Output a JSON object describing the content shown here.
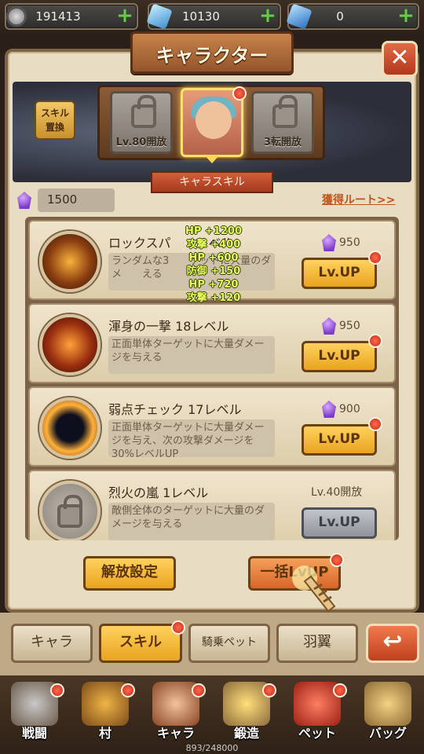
{
  "currency": [
    {
      "icon": "gear-coin-icon",
      "value": "191413"
    },
    {
      "icon": "blue-crystal-icon",
      "value": "10130"
    },
    {
      "icon": "blue-gem-icon",
      "value": "0"
    }
  ],
  "title": "キャラクター",
  "skill_swap": {
    "line1": "スキル",
    "line2": "置換"
  },
  "slots": [
    {
      "label": "Lv.80開放"
    },
    {
      "label": "3転開放"
    }
  ],
  "skill_ribbon": "キャラスキル",
  "resource": {
    "value": "1500"
  },
  "route_link": "獲得ルート>>",
  "floating_stats": [
    "HP +1200",
    "攻撃 +400",
    "HP +600",
    "防御 +150",
    "HP +720",
    "攻撃 +120"
  ],
  "skills": [
    {
      "name": "ロックスパ　　レベル",
      "desc": "ランダムな3　　ゲットに大量のダメ　　える",
      "cost": "950",
      "button": "Lv.UP",
      "locked": false
    },
    {
      "name": "渾身の一撃 18レベル",
      "desc": "正面単体ターゲットに大量ダメージを与える",
      "cost": "950",
      "button": "Lv.UP",
      "locked": false
    },
    {
      "name": "弱点チェック 17レベル",
      "desc": "正面単体ターゲットに大量ダメージを与え、次の攻撃ダメージを30%レベルUP",
      "cost": "900",
      "button": "Lv.UP",
      "locked": false
    },
    {
      "name": "烈火の嵐 1レベル",
      "desc": "敵側全体のターゲットに大量のダメージを与える",
      "cost": "Lv.40開放",
      "button": "Lv.UP",
      "locked": true
    }
  ],
  "actions": {
    "release": "解放設定",
    "bulk": "一括LvUP"
  },
  "tabs": [
    "キャラ",
    "スキル",
    "騎乗ペット",
    "羽翼"
  ],
  "nav": [
    "戦闘",
    "村",
    "キャラ",
    "鍛造",
    "ペット",
    "バッグ"
  ],
  "exp": "893/248000"
}
